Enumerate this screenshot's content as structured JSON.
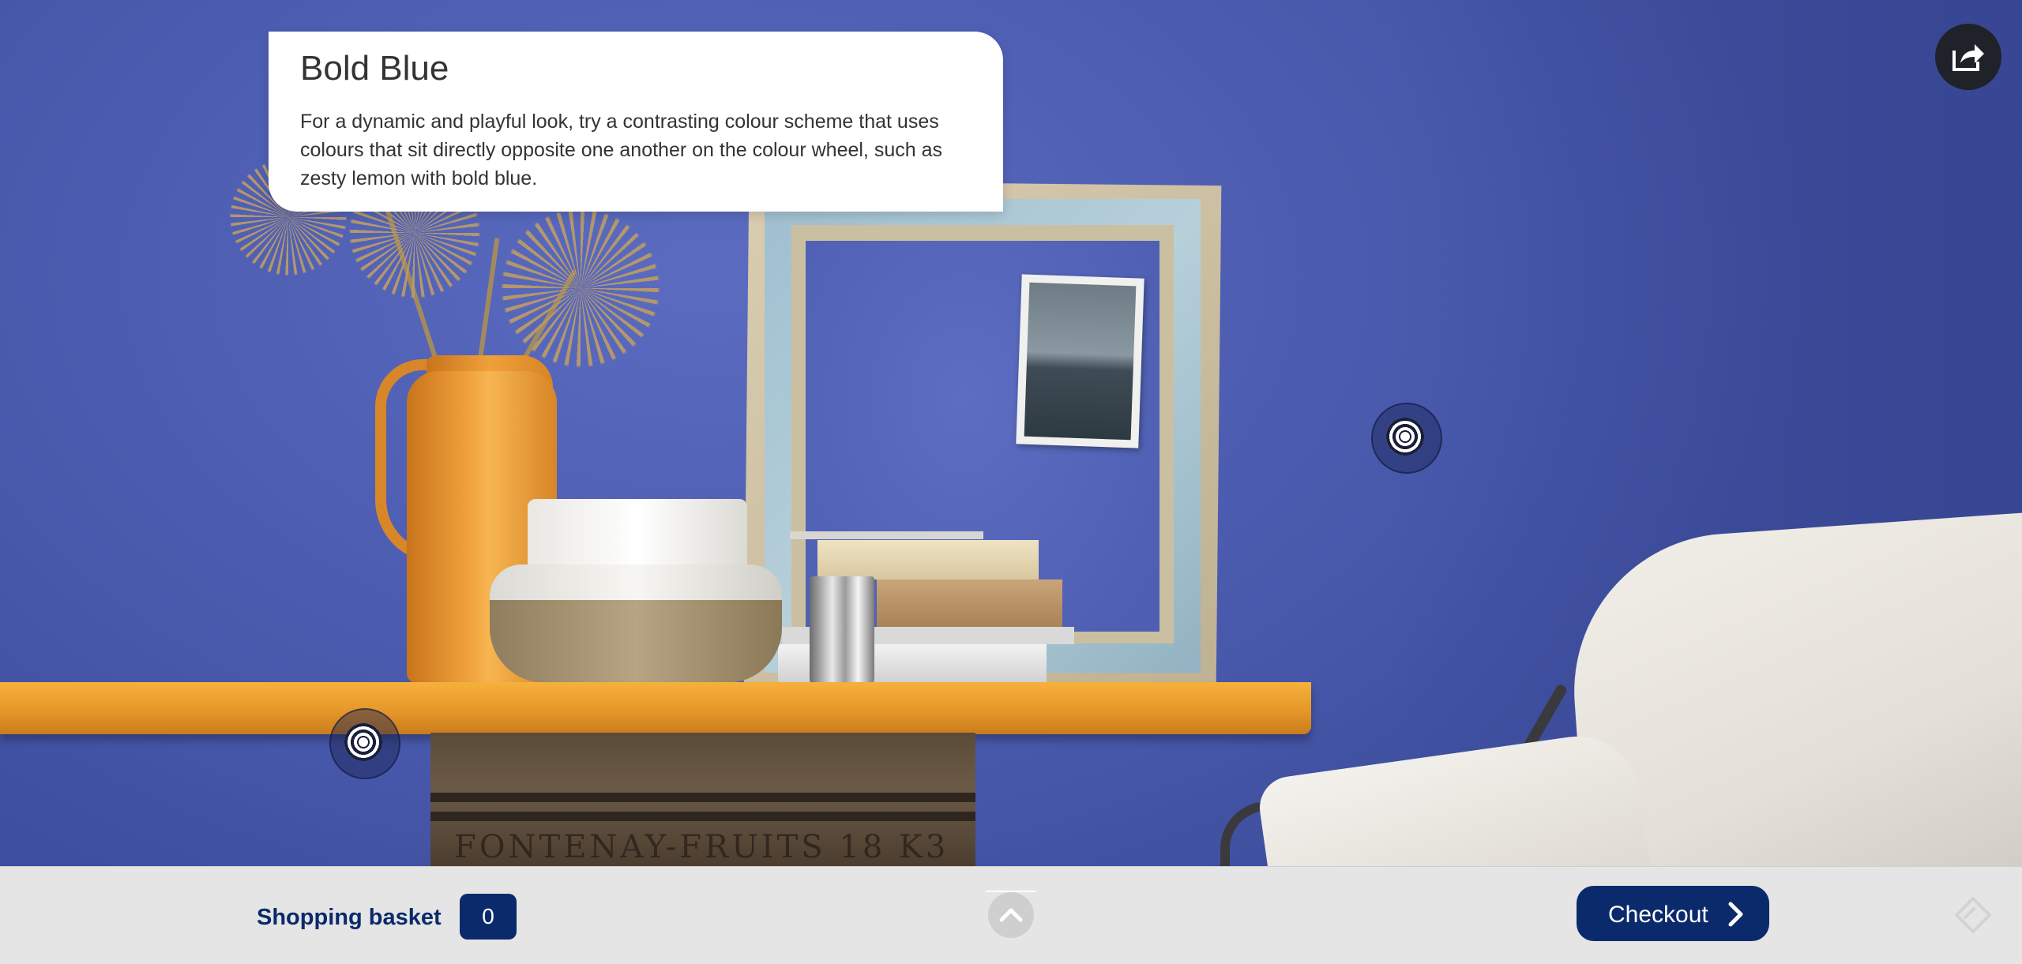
{
  "info_card": {
    "title": "Bold Blue",
    "description": "For a dynamic and playful look, try a contrasting colour scheme that uses colours that sit directly opposite one another on the colour wheel, such as zesty lemon with bold blue."
  },
  "scene": {
    "crate_text": "FONTENAY-FRUITS   18 K3"
  },
  "footer": {
    "basket_label": "Shopping basket",
    "basket_count": "0",
    "checkout_label": "Checkout"
  },
  "icons": {
    "share": "share-icon",
    "hotspot": "target-icon",
    "scroll_up": "chevron-up-icon",
    "checkout": "chevron-right-icon",
    "corner": "tag-icon"
  },
  "colors": {
    "wall": "#4c5cb0",
    "accent": "#0b2a6b",
    "footer_bg": "#e5e5e5"
  }
}
